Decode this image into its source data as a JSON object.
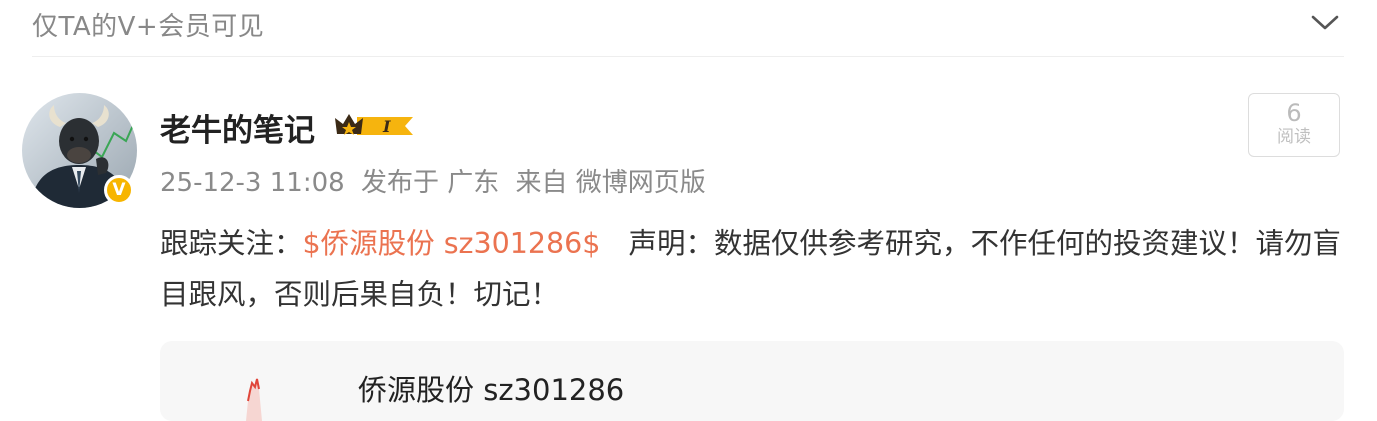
{
  "topbar": {
    "title": "仅TA的V+会员可见"
  },
  "post": {
    "author": "老牛的笔记",
    "crown_badge_text": "I",
    "verified_badge": "V",
    "date": "25-12-3 11:08",
    "location": "发布于 广东",
    "source": "来自 微博网页版",
    "read_count": "6",
    "read_label": "阅读",
    "content": {
      "prefix": "跟踪关注：",
      "stock_tag": "$侨源股份 sz301286$",
      "disclaimer": "声明：数据仅供参考研究，不作任何的投资建议！请勿盲目跟风，否则后果自负！切记！"
    },
    "card": {
      "title": "侨源股份 sz301286"
    }
  },
  "colors": {
    "link": "#eb7350",
    "badge_gold": "#f7b500",
    "muted": "#8a8a8a"
  },
  "icons": {
    "collapse": "chevron-down-icon",
    "crown": "crown-icon",
    "verified": "verified-badge-icon"
  }
}
